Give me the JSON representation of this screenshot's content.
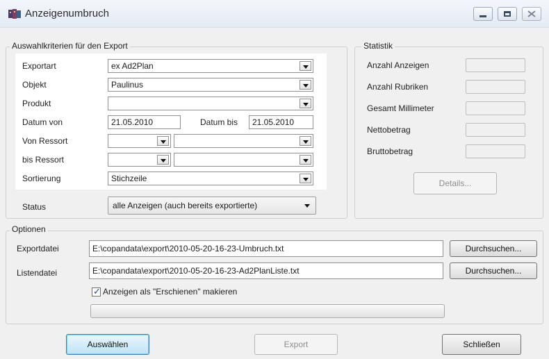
{
  "window": {
    "title": "Anzeigenumbruch"
  },
  "criteria": {
    "title": "Auswahlkriterien für den Export",
    "exportart": {
      "label": "Exportart",
      "value": "ex Ad2Plan"
    },
    "objekt": {
      "label": "Objekt",
      "value": "Paulinus"
    },
    "produkt": {
      "label": "Produkt",
      "value": ""
    },
    "datum_von": {
      "label": "Datum von",
      "value": "21.05.2010"
    },
    "datum_bis": {
      "label": "Datum bis",
      "value": "21.05.2010"
    },
    "von_ressort": {
      "label": "Von Ressort",
      "value1": "",
      "value2": ""
    },
    "bis_ressort": {
      "label": "bis Ressort",
      "value1": "",
      "value2": ""
    },
    "sortierung": {
      "label": "Sortierung",
      "value": "Stichzeile"
    },
    "status": {
      "label": "Status",
      "value": "alle Anzeigen (auch bereits exportierte)"
    }
  },
  "statistik": {
    "title": "Statistik",
    "items": [
      {
        "label": "Anzahl Anzeigen",
        "value": ""
      },
      {
        "label": "Anzahl Rubriken",
        "value": ""
      },
      {
        "label": "Gesamt Millimeter",
        "value": ""
      },
      {
        "label": "Nettobetrag",
        "value": ""
      },
      {
        "label": "Bruttobetrag",
        "value": ""
      }
    ],
    "details_label": "Details..."
  },
  "optionen": {
    "title": "Optionen",
    "exportdatei": {
      "label": "Exportdatei",
      "value": "E:\\copandata\\export\\2010-05-20-16-23-Umbruch.txt"
    },
    "listendatei": {
      "label": "Listendatei",
      "value": "E:\\copandata\\export\\2010-05-20-16-23-Ad2PlanListe.txt"
    },
    "browse_label": "Durchsuchen...",
    "mark_published": {
      "label": "Anzeigen als \"Erschienen\" makieren",
      "checked": true
    },
    "progress": 0
  },
  "footer": {
    "select_label": "Auswählen",
    "export_label": "Export",
    "close_label": "Schließen"
  }
}
